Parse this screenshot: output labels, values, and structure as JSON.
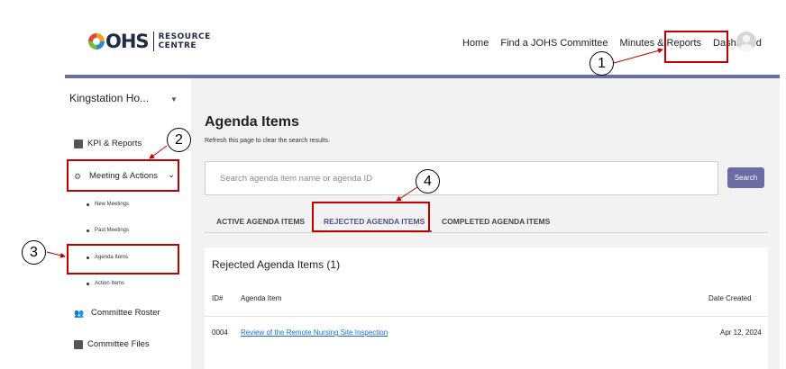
{
  "header": {
    "logo_mark": "OHS",
    "logo_text_line1": "RESOURCE",
    "logo_text_line2": "CENTRE",
    "nav": [
      "Home",
      "Find a JOHS Committee",
      "Minutes & Reports",
      "Dashboard"
    ],
    "accent_color": "#6c6ca4"
  },
  "sidebar": {
    "org_name": "Kingstation Ho...",
    "items": [
      {
        "label": "KPI & Reports",
        "icon": "chart-icon"
      },
      {
        "label": "Meeting & Actions",
        "icon": "meetings-icon"
      },
      {
        "label": "Committee Roster",
        "icon": "people-icon"
      },
      {
        "label": "Committee Files",
        "icon": "folder-icon"
      }
    ],
    "sub_items": [
      "New Meetings",
      "Past Meetings",
      "Agenda Items",
      "Action Items"
    ]
  },
  "main": {
    "title": "Agenda Items",
    "subtitle": "Refresh this page to clear the search results.",
    "search_placeholder": "Search agenda item name or agenda ID",
    "search_button": "Search",
    "tabs": [
      "ACTIVE AGENDA ITEMS",
      "REJECTED AGENDA ITEMS",
      "COMPLETED AGENDA ITEMS"
    ],
    "card_title": "Rejected Agenda Items (1)",
    "columns": [
      "ID#",
      "Agenda Item",
      "Date Created"
    ],
    "rows": [
      {
        "id": "0004",
        "item": "Review of the Remote Nursing Site Inspection",
        "date": "Apr 12, 2024"
      }
    ]
  },
  "annotations": [
    "1",
    "2",
    "3",
    "4"
  ]
}
